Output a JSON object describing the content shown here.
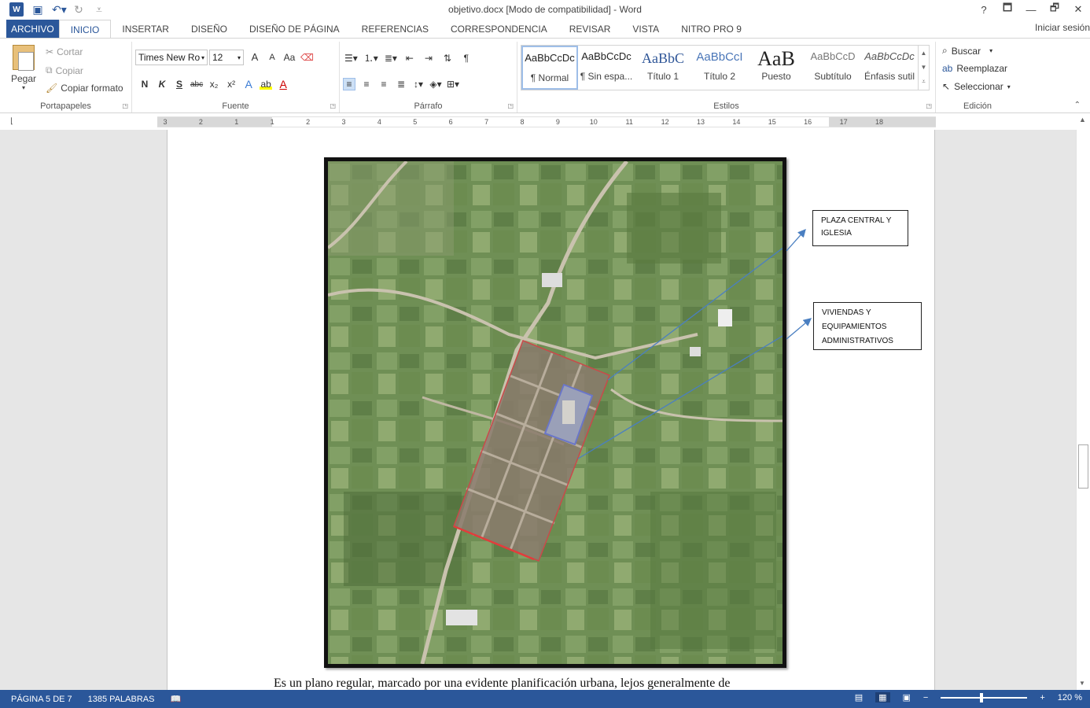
{
  "window": {
    "title": "objetivo.docx [Modo de compatibilidad] - Word",
    "help": "?",
    "controls": [
      "🗖",
      "—",
      "🗗",
      "✕"
    ],
    "sign_in": "Iniciar sesión"
  },
  "qat": {
    "logo": "W",
    "icons": [
      "save-icon",
      "undo-icon",
      "redo-icon",
      "customize-icon"
    ]
  },
  "tabs": [
    "ARCHIVO",
    "INICIO",
    "INSERTAR",
    "DISEÑO",
    "DISEÑO DE PÁGINA",
    "REFERENCIAS",
    "CORRESPONDENCIA",
    "REVISAR",
    "VISTA",
    "NITRO PRO 9"
  ],
  "ribbon": {
    "clipboard": {
      "paste": "Pegar",
      "cut": "Cortar",
      "copy": "Copiar",
      "format_painter": "Copiar formato",
      "label": "Portapapeles"
    },
    "font": {
      "name": "Times New Ro",
      "size": "12",
      "grow": "A",
      "shrink": "A",
      "case": "Aa",
      "bold": "N",
      "italic": "K",
      "underline": "S",
      "strike": "abc",
      "sub": "x₂",
      "sup": "x²",
      "effects": "A",
      "color": "A",
      "label": "Fuente"
    },
    "paragraph": {
      "pilcrow": "¶",
      "label": "Párrafo"
    },
    "styles": {
      "items": [
        {
          "sample": "AaBbCcDc",
          "name": "¶ Normal"
        },
        {
          "sample": "AaBbCcDc",
          "name": "¶ Sin espa..."
        },
        {
          "sample": "AaBbC",
          "name": "Título 1"
        },
        {
          "sample": "AaBbCcI",
          "name": "Título 2"
        },
        {
          "sample": "AaB",
          "name": "Puesto"
        },
        {
          "sample": "AaBbCcD",
          "name": "Subtítulo"
        },
        {
          "sample": "AaBbCcDc",
          "name": "Énfasis sutil"
        }
      ],
      "label": "Estilos"
    },
    "editing": {
      "find": "Buscar",
      "replace": "Reemplazar",
      "select": "Seleccionar",
      "label": "Edición"
    }
  },
  "ruler": {
    "ticks": [
      "3",
      "2",
      "1",
      "1",
      "2",
      "3",
      "4",
      "5",
      "6",
      "7",
      "8",
      "9",
      "10",
      "11",
      "12",
      "13",
      "14",
      "15",
      "16",
      "17",
      "18"
    ]
  },
  "document": {
    "callouts": [
      {
        "lines": [
          "PLAZA CENTRAL  Y",
          "IGLESIA"
        ]
      },
      {
        "lines": [
          "VIVIENDAS Y",
          "EQUIPAMIENTOS",
          "ADMINISTRATIVOS"
        ]
      }
    ],
    "body_text": "Es un plano regular, marcado por una evidente planificación urbana, lejos generalmente de"
  },
  "statusbar": {
    "page": "PÁGINA 5 DE 7",
    "words": "1385 PALABRAS",
    "zoom": "120 %"
  }
}
